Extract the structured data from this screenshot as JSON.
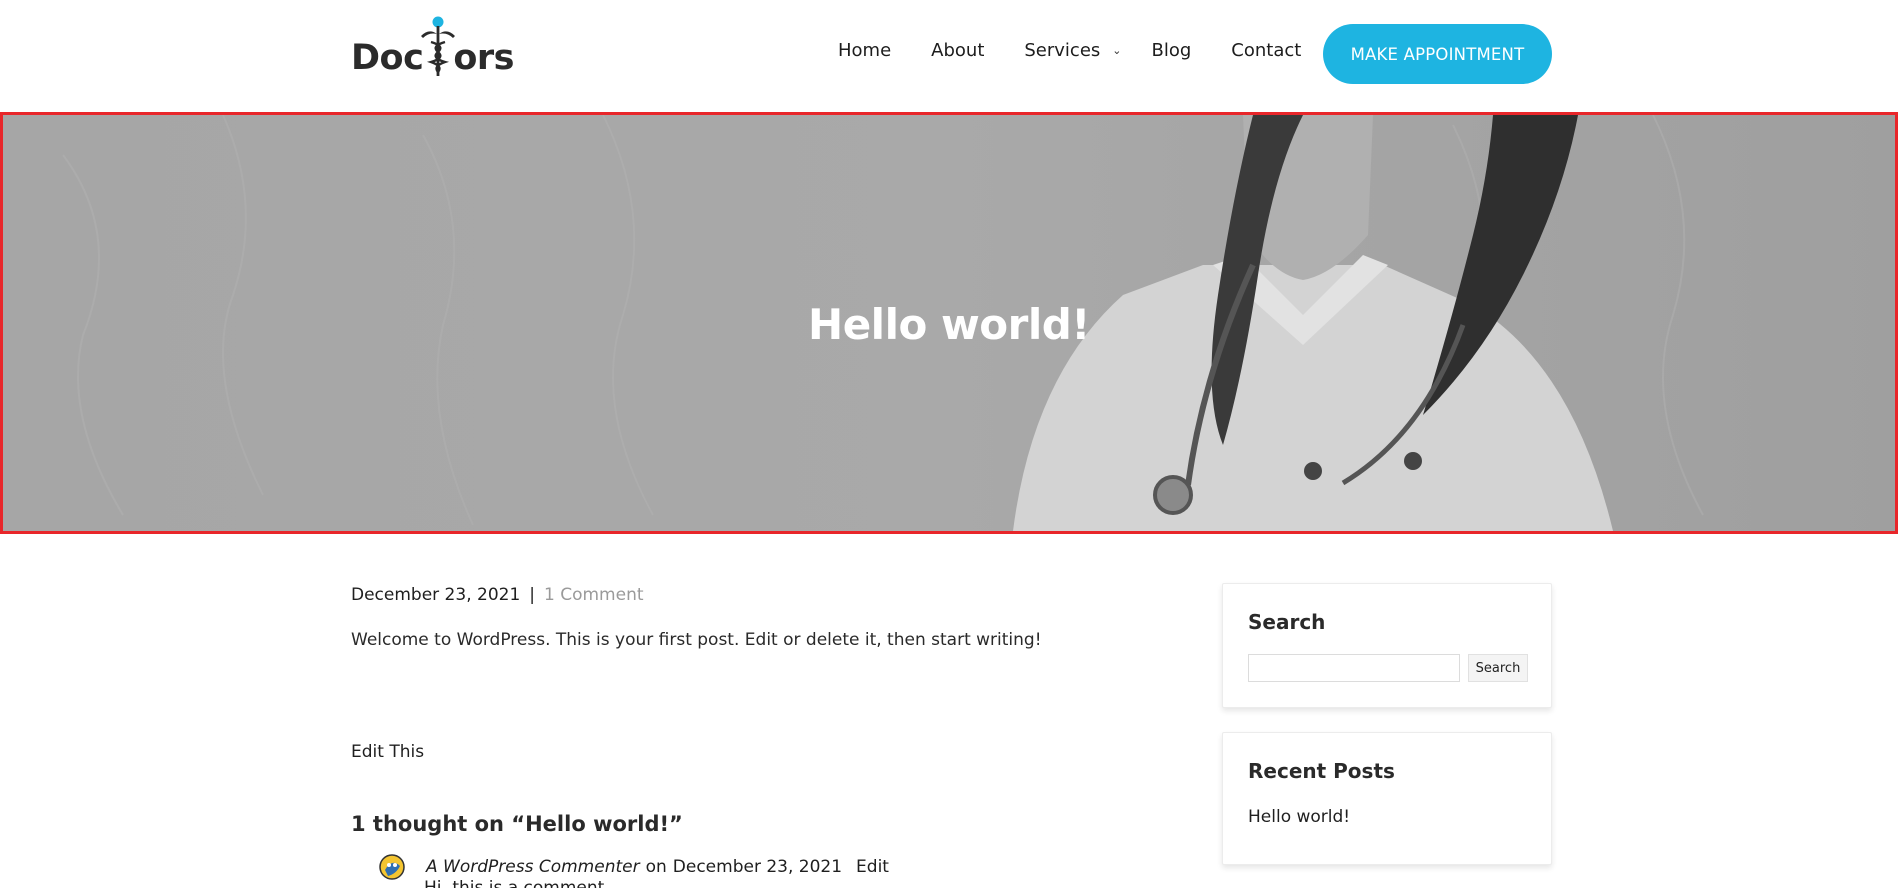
{
  "brand": {
    "logo_left": "Doc",
    "logo_right": "ors",
    "accent": "#1eb4e1"
  },
  "nav": {
    "items": [
      {
        "label": "Home"
      },
      {
        "label": "About"
      },
      {
        "label": "Services",
        "has_dropdown": true
      },
      {
        "label": "Blog"
      },
      {
        "label": "Contact"
      }
    ],
    "cta": "MAKE APPOINTMENT"
  },
  "hero": {
    "title": "Hello world!",
    "highlight_color": "#e8262a"
  },
  "post": {
    "date": "December 23, 2021",
    "separator": "|",
    "comments_link": "1 Comment",
    "body": "Welcome to WordPress. This is your first post. Edit or delete it, then start writing!",
    "edit_link": "Edit This"
  },
  "comments": {
    "heading": "1 thought on “Hello world!”",
    "items": [
      {
        "author": "A WordPress Commenter",
        "on": "on",
        "date": "December 23, 2021",
        "edit": "Edit",
        "text": "Hi, this is a comment."
      }
    ]
  },
  "sidebar": {
    "search": {
      "title": "Search",
      "input_value": "",
      "button": "Search"
    },
    "recent": {
      "title": "Recent Posts",
      "items": [
        "Hello world!"
      ]
    }
  }
}
